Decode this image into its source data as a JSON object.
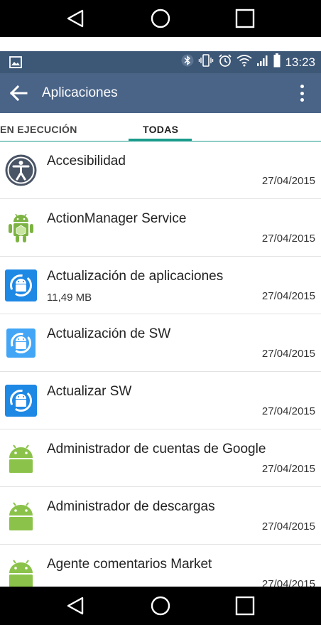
{
  "status_bar": {
    "time": "13:23"
  },
  "app_bar": {
    "title": "Aplicaciones"
  },
  "tabs": [
    {
      "label": "EN EJECUCIÓN"
    },
    {
      "label": "TODAS"
    }
  ],
  "apps": [
    {
      "name": "Accesibilidad",
      "size": "",
      "date": "27/04/2015",
      "icon": "accessibility-icon"
    },
    {
      "name": "ActionManager Service",
      "size": "",
      "date": "27/04/2015",
      "icon": "android-box-icon"
    },
    {
      "name": "Actualización de aplicaciones",
      "size": "11,49 MB",
      "date": "27/04/2015",
      "icon": "update-icon"
    },
    {
      "name": "Actualización de SW",
      "size": "",
      "date": "27/04/2015",
      "icon": "update-icon"
    },
    {
      "name": "Actualizar SW",
      "size": "",
      "date": "27/04/2015",
      "icon": "update-icon"
    },
    {
      "name": "Administrador de cuentas de Google",
      "size": "",
      "date": "27/04/2015",
      "icon": "android-icon"
    },
    {
      "name": "Administrador de descargas",
      "size": "",
      "date": "27/04/2015",
      "icon": "android-icon"
    },
    {
      "name": "Agente comentarios Market",
      "size": "",
      "date": "27/04/2015",
      "icon": "android-icon"
    }
  ],
  "colors": {
    "status_bar": "#3d5777",
    "app_bar": "#4a6488",
    "tab_indicator": "#1a9b8c",
    "android_green": "#8bc34a",
    "update_blue": "#1e88e5"
  }
}
